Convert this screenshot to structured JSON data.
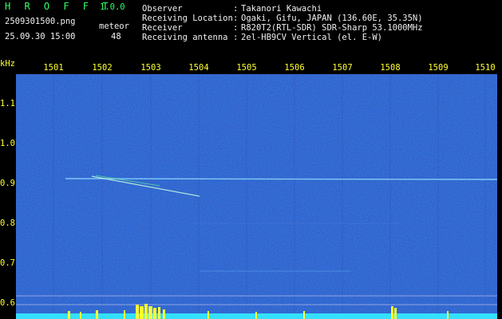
{
  "header": {
    "app_title": "H R O F F T",
    "version": "1.0.0",
    "filename": "2509301500.png",
    "timestamp": "25.09.30 15:00",
    "meteor_label": "meteor",
    "meteor_count": "48"
  },
  "info": [
    {
      "label": "Observer",
      "value": "Takanori Kawachi"
    },
    {
      "label": "Receiving Location",
      "value": "Ogaki, Gifu, JAPAN (136.60E, 35.35N)"
    },
    {
      "label": "Receiver",
      "value": "R820T2(RTL-SDR) SDR-Sharp 53.1000MHz"
    },
    {
      "label": "Receiving antenna",
      "value": "2el-HB9CV Vertical (el. E-W)"
    }
  ],
  "axes": {
    "y_unit": "kHz",
    "x_ticks": [
      "1501",
      "1502",
      "1503",
      "1504",
      "1505",
      "1506",
      "1507",
      "1508",
      "1509",
      "1510"
    ],
    "y_ticks": [
      "1.1",
      "1.0",
      "0.9",
      "0.8",
      "0.7",
      "0.6"
    ]
  },
  "colors": {
    "background": "#000000",
    "label": "#ffff33",
    "title": "#33ff66",
    "noise_base": "#0b1a6e",
    "signal": "#9fe8ff"
  }
}
